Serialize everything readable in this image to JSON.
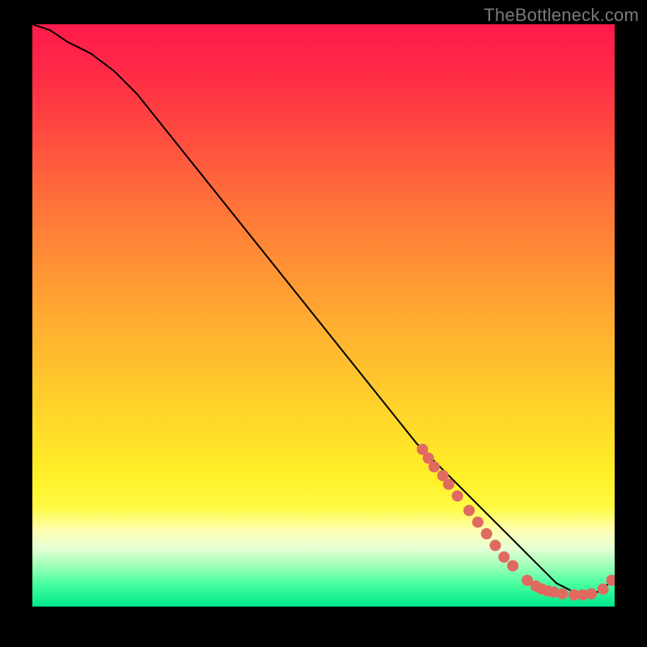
{
  "watermark": "TheBottleneck.com",
  "chart_data": {
    "type": "line",
    "title": "",
    "xlabel": "",
    "ylabel": "",
    "xlim": [
      0,
      100
    ],
    "ylim": [
      0,
      100
    ],
    "grid": false,
    "background_gradient": {
      "stops": [
        {
          "offset": 0.0,
          "color": "#ff1a4b"
        },
        {
          "offset": 0.08,
          "color": "#ff2a47"
        },
        {
          "offset": 0.18,
          "color": "#ff4840"
        },
        {
          "offset": 0.3,
          "color": "#ff6f3a"
        },
        {
          "offset": 0.42,
          "color": "#ff9334"
        },
        {
          "offset": 0.55,
          "color": "#ffb72f"
        },
        {
          "offset": 0.68,
          "color": "#ffd829"
        },
        {
          "offset": 0.78,
          "color": "#fff028"
        },
        {
          "offset": 0.83,
          "color": "#fffb44"
        },
        {
          "offset": 0.87,
          "color": "#fdffb4"
        },
        {
          "offset": 0.9,
          "color": "#e5ffd4"
        },
        {
          "offset": 0.93,
          "color": "#9fffb9"
        },
        {
          "offset": 0.96,
          "color": "#4affa0"
        },
        {
          "offset": 1.0,
          "color": "#00e889"
        }
      ]
    },
    "series": [
      {
        "name": "bottleneck-curve",
        "color": "#000000",
        "width": 2,
        "x": [
          0,
          3,
          6,
          10,
          14,
          18,
          22,
          26,
          30,
          34,
          38,
          42,
          46,
          50,
          54,
          58,
          62,
          66,
          70,
          74,
          78,
          82,
          84,
          86,
          88,
          90,
          92,
          94,
          96,
          98,
          100
        ],
        "y": [
          100,
          99,
          97,
          95,
          92,
          88,
          83,
          78,
          73,
          68,
          63,
          58,
          53,
          48,
          43,
          38,
          33,
          28,
          24,
          20,
          16,
          12,
          10,
          8,
          6,
          4,
          3,
          2,
          2,
          3,
          5
        ]
      }
    ],
    "markers": {
      "name": "highlight-dots",
      "color": "#e06a60",
      "radius": 7,
      "points": [
        {
          "x": 67,
          "y": 27
        },
        {
          "x": 68,
          "y": 25.5
        },
        {
          "x": 69,
          "y": 24
        },
        {
          "x": 70.5,
          "y": 22.5
        },
        {
          "x": 71.5,
          "y": 21
        },
        {
          "x": 73,
          "y": 19
        },
        {
          "x": 75,
          "y": 16.5
        },
        {
          "x": 76.5,
          "y": 14.5
        },
        {
          "x": 78,
          "y": 12.5
        },
        {
          "x": 79.5,
          "y": 10.5
        },
        {
          "x": 81,
          "y": 8.5
        },
        {
          "x": 82.5,
          "y": 7
        },
        {
          "x": 85,
          "y": 4.5
        },
        {
          "x": 86.5,
          "y": 3.5
        },
        {
          "x": 87.5,
          "y": 3
        },
        {
          "x": 88.5,
          "y": 2.7
        },
        {
          "x": 89.5,
          "y": 2.5
        },
        {
          "x": 91,
          "y": 2.2
        },
        {
          "x": 93,
          "y": 2
        },
        {
          "x": 94.5,
          "y": 2
        },
        {
          "x": 96,
          "y": 2.2
        },
        {
          "x": 98,
          "y": 3
        },
        {
          "x": 99.5,
          "y": 4.5
        }
      ]
    }
  }
}
